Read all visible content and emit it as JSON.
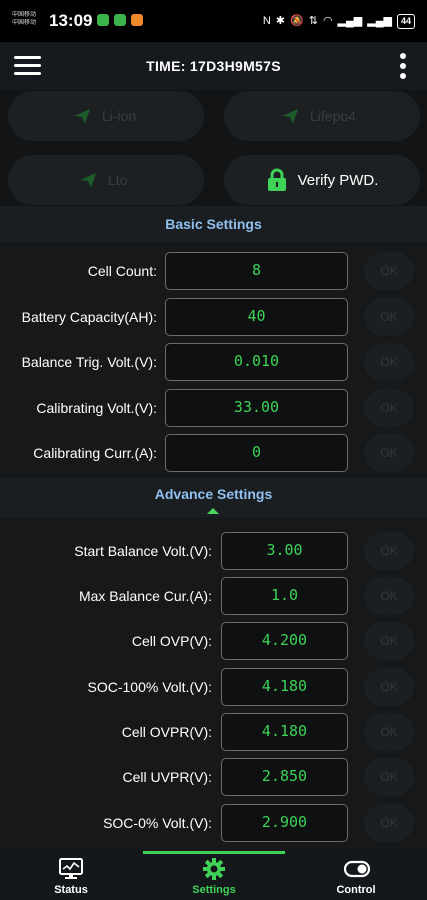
{
  "status_bar": {
    "carrier_1": "中国移动",
    "carrier_2": "中国移动",
    "time": "13:09",
    "battery": "44"
  },
  "app_bar": {
    "title": "TIME: 17D3H9M57S"
  },
  "battery_types": {
    "li_ion": "Li-ion",
    "lifepo4": "Lifepo4",
    "lto": "Lto",
    "verify": "Verify PWD."
  },
  "basic_settings": {
    "title": "Basic Settings",
    "rows": [
      {
        "label": "Cell Count:",
        "value": "8",
        "ok": "OK"
      },
      {
        "label": "Battery Capacity(AH):",
        "value": "40",
        "ok": "OK"
      },
      {
        "label": "Balance Trig. Volt.(V):",
        "value": "0.010",
        "ok": "OK"
      },
      {
        "label": "Calibrating Volt.(V):",
        "value": "33.00",
        "ok": "OK"
      },
      {
        "label": "Calibrating Curr.(A):",
        "value": "0",
        "ok": "OK"
      }
    ]
  },
  "advance_settings": {
    "title": "Advance Settings",
    "rows": [
      {
        "label": "Start Balance Volt.(V):",
        "value": "3.00",
        "ok": "OK"
      },
      {
        "label": "Max Balance Cur.(A):",
        "value": "1.0",
        "ok": "OK"
      },
      {
        "label": "Cell OVP(V):",
        "value": "4.200",
        "ok": "OK"
      },
      {
        "label": "SOC-100% Volt.(V):",
        "value": "4.180",
        "ok": "OK"
      },
      {
        "label": "Cell OVPR(V):",
        "value": "4.180",
        "ok": "OK"
      },
      {
        "label": "Cell UVPR(V):",
        "value": "2.850",
        "ok": "OK"
      },
      {
        "label": "SOC-0% Volt.(V):",
        "value": "2.900",
        "ok": "OK"
      }
    ]
  },
  "bottom_nav": {
    "status": "Status",
    "settings": "Settings",
    "control": "Control",
    "active": "settings"
  },
  "colors": {
    "accent_green": "#3ed356",
    "section_title_blue": "#8fc0f0"
  }
}
